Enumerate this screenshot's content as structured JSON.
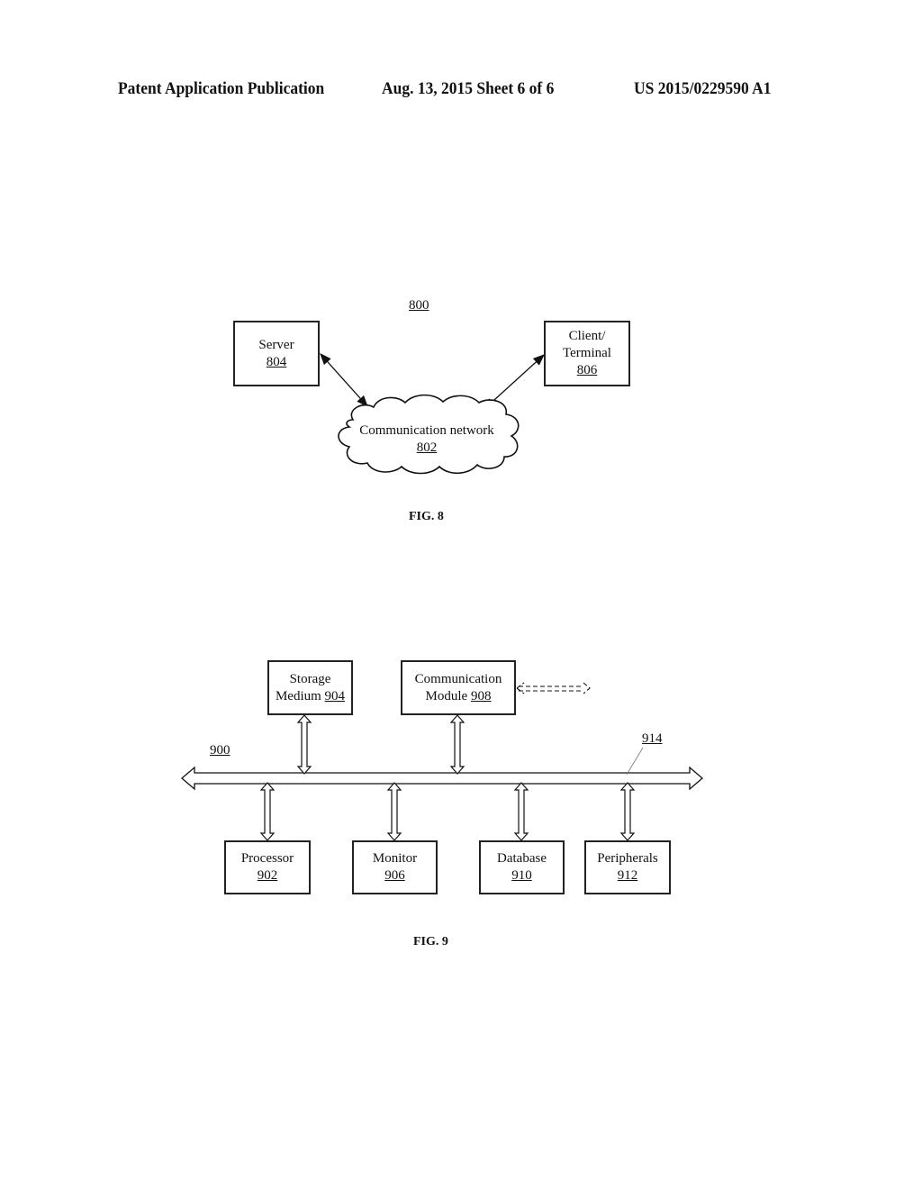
{
  "header": {
    "publication": "Patent Application Publication",
    "date_sheet": "Aug. 13, 2015  Sheet 6 of 6",
    "number": "US 2015/0229590 A1"
  },
  "fig8": {
    "ref": "800",
    "caption": "FIG. 8",
    "server": {
      "label": "Server",
      "ref": "804"
    },
    "client": {
      "label1": "Client/",
      "label2": "Terminal",
      "ref": "806"
    },
    "network": {
      "label": "Communication network",
      "ref": "802"
    }
  },
  "fig9": {
    "ref": "900",
    "bus_ref": "914",
    "caption": "FIG. 9",
    "storage": {
      "label1": "Storage",
      "label2": "Medium ",
      "ref": "904"
    },
    "comm": {
      "label1": "Communication",
      "label2": "Module ",
      "ref": "908"
    },
    "processor": {
      "label": "Processor",
      "ref": "902"
    },
    "monitor": {
      "label": "Monitor",
      "ref": "906"
    },
    "database": {
      "label": "Database",
      "ref": "910"
    },
    "peripherals": {
      "label": "Peripherals",
      "ref": "912"
    }
  }
}
